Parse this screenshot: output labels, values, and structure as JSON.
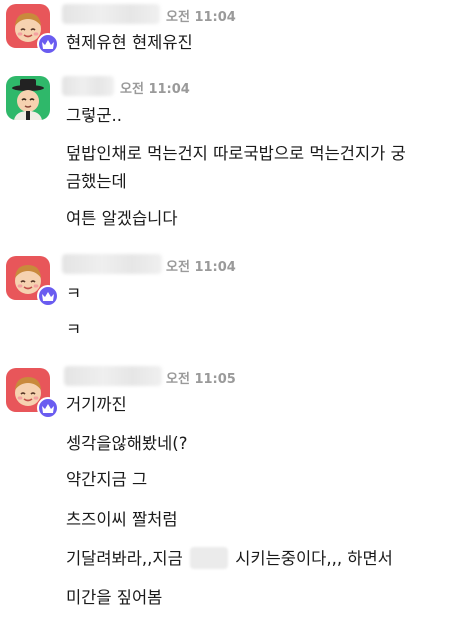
{
  "groups": [
    {
      "avatar_icon": "user-avatar-red-icon",
      "badge_icon": "crown-icon",
      "time": "오전 11:04",
      "messages": [
        "현제유현 현제유진"
      ]
    },
    {
      "avatar_icon": "user-avatar-green-hat-icon",
      "time": "오전 11:04",
      "messages": [
        "그렇군..",
        "덮밥인채로 먹는건지 따로국밥으로 먹는건지가 궁",
        "금했는데",
        "여튼 알겠습니다"
      ]
    },
    {
      "avatar_icon": "user-avatar-red-icon",
      "badge_icon": "crown-icon",
      "time": "오전 11:04",
      "messages": [
        "ㅋ",
        "ㅋ"
      ]
    },
    {
      "avatar_icon": "user-avatar-red-icon",
      "badge_icon": "crown-icon",
      "time": "오전 11:05",
      "messages": [
        "거기까진",
        "셍각을않해봤네(?",
        "약간지금 그",
        "츠즈이씨 짤처럼",
        "기달려봐라,,지금",
        "시키는중이다,,, 하면서",
        "미간을 짚어봄"
      ]
    }
  ],
  "colors": {
    "crown_badge": "#6a5cf0",
    "time_text": "#9a9a9a",
    "avatar_red": "#e8565a",
    "avatar_green": "#2fb86a"
  }
}
